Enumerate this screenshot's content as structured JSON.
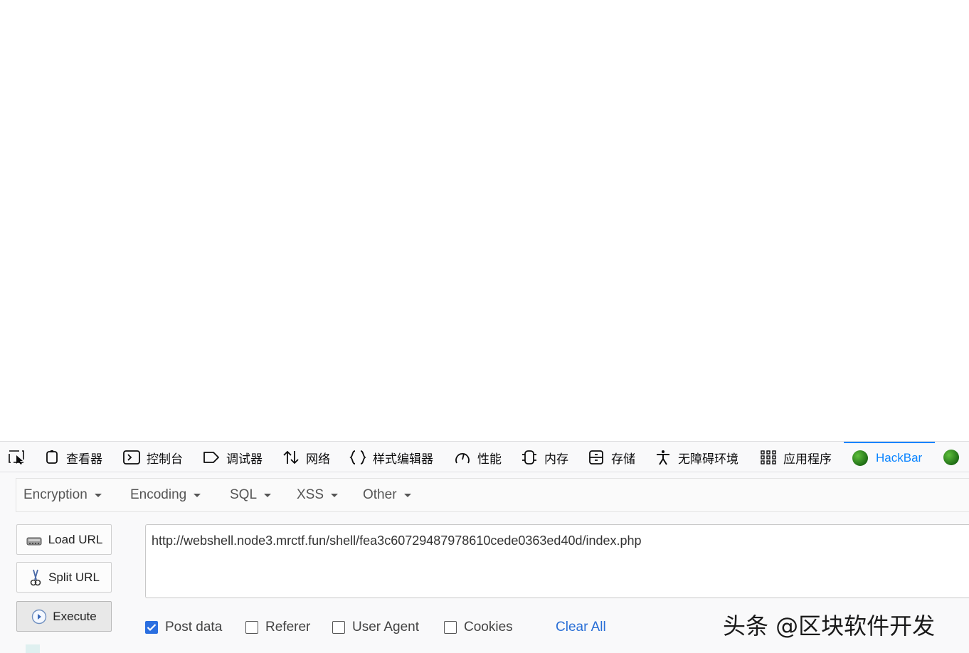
{
  "devtools_tabs": [
    {
      "label": "",
      "icon": "element-picker-icon"
    },
    {
      "label": "查看器",
      "icon": "inspector-icon"
    },
    {
      "label": "控制台",
      "icon": "console-icon"
    },
    {
      "label": "调试器",
      "icon": "debugger-icon"
    },
    {
      "label": "网络",
      "icon": "network-icon"
    },
    {
      "label": "样式编辑器",
      "icon": "style-editor-icon"
    },
    {
      "label": "性能",
      "icon": "performance-icon"
    },
    {
      "label": "内存",
      "icon": "memory-icon"
    },
    {
      "label": "存储",
      "icon": "storage-icon"
    },
    {
      "label": "无障碍环境",
      "icon": "accessibility-icon"
    },
    {
      "label": "应用程序",
      "icon": "application-icon"
    },
    {
      "label": "HackBar",
      "icon": "hackbar-globe-icon",
      "active": true
    },
    {
      "label": "",
      "icon": "globe-icon"
    }
  ],
  "hackbar": {
    "menus": [
      "Encryption",
      "Encoding",
      "SQL",
      "XSS",
      "Other"
    ],
    "buttons": {
      "load_url": "Load URL",
      "split_url": "Split URL",
      "execute": "Execute"
    },
    "url_value": "http://webshell.node3.mrctf.fun/shell/fea3c60729487978610cede0363ed40d/index.php",
    "options": [
      {
        "label": "Post data",
        "checked": true
      },
      {
        "label": "Referer",
        "checked": false
      },
      {
        "label": "User Agent",
        "checked": false
      },
      {
        "label": "Cookies",
        "checked": false
      }
    ],
    "clear_all": "Clear All"
  },
  "watermark": "头条 @区块软件开发",
  "colors": {
    "accent": "#0a84ff",
    "link": "#2a6fd6",
    "checkbox": "#2b6fe0"
  }
}
